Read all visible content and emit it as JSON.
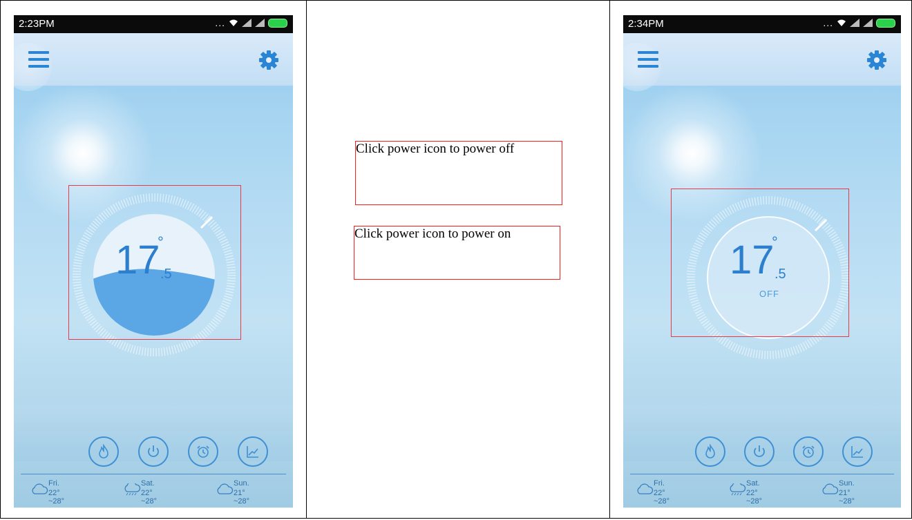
{
  "screens": [
    {
      "status_time": "2:23PM",
      "status_dots": "...",
      "temperature_integer": "17",
      "temperature_decimal": ".5",
      "degree_symbol": "°",
      "forecast": [
        {
          "day": "Fri.",
          "range": "22° ~28°",
          "icon": "cloud-icon"
        },
        {
          "day": "Sat.",
          "range": "22° ~28°",
          "icon": "rain-cloud-icon"
        },
        {
          "day": "Sun.",
          "range": "21° ~28°",
          "icon": "cloud-icon"
        }
      ]
    },
    {
      "status_time": "2:34PM",
      "status_dots": "...",
      "temperature_integer": "17",
      "temperature_decimal": ".5",
      "degree_symbol": "°",
      "power_state": "OFF",
      "forecast": [
        {
          "day": "Fri.",
          "range": "22° ~28°",
          "icon": "cloud-icon"
        },
        {
          "day": "Sat.",
          "range": "22° ~28°",
          "icon": "rain-cloud-icon"
        },
        {
          "day": "Sun.",
          "range": "21° ~28°",
          "icon": "cloud-icon"
        }
      ]
    }
  ],
  "controls": [
    "flame-icon",
    "power-icon",
    "alarm-clock-icon",
    "chart-icon"
  ],
  "notes": {
    "power_off": "Click power icon to power off",
    "power_on": "Click power icon to power on"
  },
  "colors": {
    "accent_blue": "#2b7fcd",
    "annotation_red": "#ff1a1a",
    "battery_green": "#2bd14c"
  }
}
